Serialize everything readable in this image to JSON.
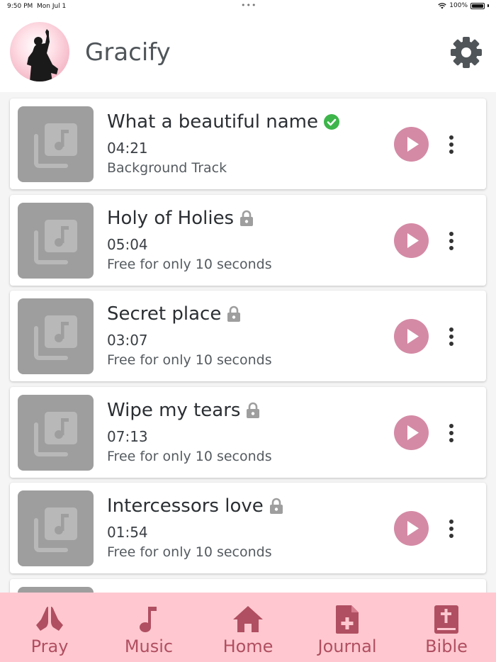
{
  "status_bar": {
    "time": "9:50 PM",
    "date": "Mon Jul 1",
    "dots": "•••",
    "battery": "100%"
  },
  "app": {
    "title": "Gracify"
  },
  "songs": [
    {
      "title": "What a beautiful name",
      "duration": "04:21",
      "subtitle": "Background Track",
      "badge": "check-icon"
    },
    {
      "title": "Holy of Holies",
      "duration": "05:04",
      "subtitle": "Free for only 10 seconds",
      "badge": "lock-icon"
    },
    {
      "title": "Secret place",
      "duration": "03:07",
      "subtitle": "Free for only 10 seconds",
      "badge": "lock-icon"
    },
    {
      "title": "Wipe my tears",
      "duration": "07:13",
      "subtitle": "Free for only 10 seconds",
      "badge": "lock-icon"
    },
    {
      "title": "Intercessors love",
      "duration": "01:54",
      "subtitle": "Free for only 10 seconds",
      "badge": "lock-icon"
    }
  ],
  "nav": [
    {
      "label": "Pray",
      "icon": "praying-hands-icon"
    },
    {
      "label": "Music",
      "icon": "music-note-icon"
    },
    {
      "label": "Home",
      "icon": "home-icon"
    },
    {
      "label": "Journal",
      "icon": "journal-icon"
    },
    {
      "label": "Bible",
      "icon": "bible-icon"
    }
  ],
  "colors": {
    "accent": "#d48aa5",
    "nav_background": "#ffc8d0",
    "nav_icon": "#b04f61",
    "verified": "#3db54a",
    "lock": "#9e9e9e",
    "thumbnail": "#9e9e9e"
  }
}
